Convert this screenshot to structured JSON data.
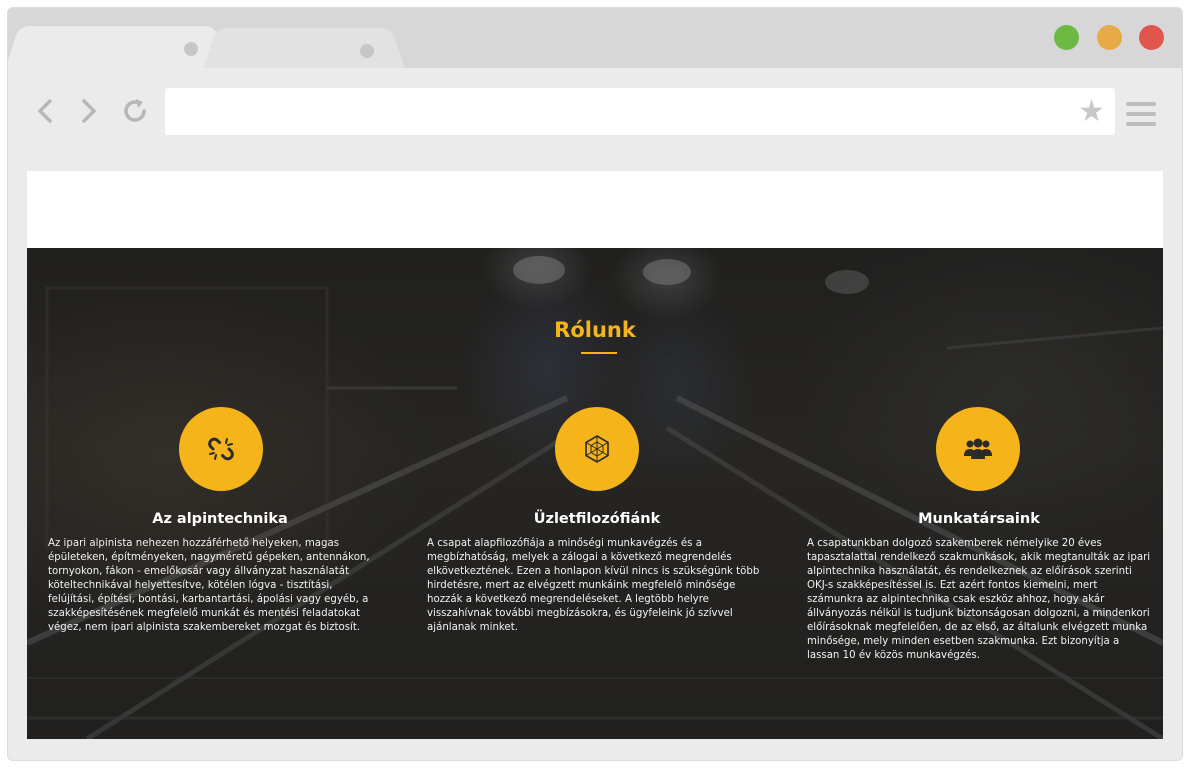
{
  "browser": {
    "tabs": [
      {
        "label": ""
      },
      {
        "label": ""
      }
    ],
    "url": "",
    "icons": {
      "back": "back-arrow-icon",
      "forward": "forward-arrow-icon",
      "reload": "reload-icon",
      "bookmark": "star-icon",
      "menu": "hamburger-menu-icon"
    },
    "window_buttons": {
      "green": "#6cb944",
      "yellow": "#e7aa46",
      "red": "#e0564d"
    }
  },
  "page": {
    "section_title": "Rólunk",
    "accent_color": "#f5b51a",
    "features": [
      {
        "icon": "broken-link-icon",
        "title": "Az alpintechnika",
        "text": "Az ipari alpinista nehezen hozzáférhető helyeken, magas épületeken, építményeken, nagyméretű gépeken, antennákon, tornyokon, fákon - emelőkosár vagy állványzat használatát köteltechnikával helyettesítve, kötélen lógva - tisztítási, felújítási, építési, bontási, karbantartási, ápolási vagy egyéb, a szakképesítésének megfelelő munkát és mentési feladatokat végez, nem ipari alpinista szakembereket mozgat és biztosít."
      },
      {
        "icon": "hexagon-network-icon",
        "title": "Üzletfilozófiánk",
        "text": "A csapat alapfilozófiája a minőségi munkavégzés és a megbízhatóság, melyek a zálogai a következő megrendelés elkövetkeztének. Ezen a honlapon kívül nincs is szükségünk több hirdetésre, mert az elvégzett munkáink megfelelő minősége hozzák a következő megrendeléseket. A legtöbb helyre visszahívnak további megbízásokra, és ügyfeleink jó szívvel ajánlanak minket."
      },
      {
        "icon": "users-group-icon",
        "title": "Munkatársaink",
        "text": "A csapatunkban dolgozó szakemberek némelyike 20 éves tapasztalattal rendelkező szakmunkások, akik megtanulták az ipari alpintechnika használatát, és rendelkeznek az előírások szerinti OKJ-s szakképesítéssel is. Ezt azért fontos kiemelni, mert számunkra az alpintechnika csak eszköz ahhoz, hogy akár állványozás nélkül is tudjunk biztonságosan dolgozni, a mindenkori előírásoknak megfelelően, de az első, az általunk elvégzett munka minősége, mely minden esetben szakmunka. Ezt bizonyítja a lassan 10 év közös munkavégzés."
      }
    ]
  }
}
